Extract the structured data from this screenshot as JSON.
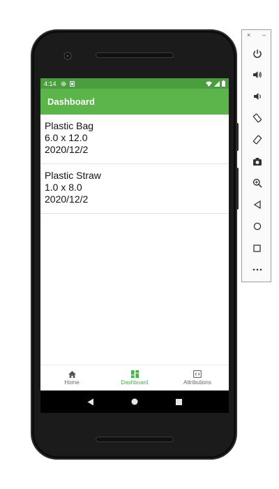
{
  "status_bar": {
    "time": "4:14",
    "icons": [
      "settings-icon",
      "sim-icon",
      "wifi-icon",
      "signal-icon",
      "battery-icon"
    ]
  },
  "app_bar": {
    "title": "Dashboard"
  },
  "list": {
    "items": [
      {
        "name": "Plastic Bag",
        "size": "6.0 x 12.0",
        "date": "2020/12/2"
      },
      {
        "name": "Plastic Straw",
        "size": "1.0 x 8.0",
        "date": "2020/12/2"
      }
    ]
  },
  "bottom_nav": {
    "items": [
      {
        "label": "Home",
        "icon": "home-icon",
        "active": false
      },
      {
        "label": "Dashboard",
        "icon": "dashboard-icon",
        "active": true
      },
      {
        "label": "Attributions",
        "icon": "code-icon",
        "active": false
      }
    ]
  },
  "system_nav": {
    "icons": [
      "back-icon",
      "home-circle-icon",
      "recents-icon"
    ]
  },
  "emulator_toolbar": {
    "close_glyph": "×",
    "minimize_glyph": "–",
    "buttons": [
      "power-icon",
      "volume-up-icon",
      "volume-down-icon",
      "rotate-left-icon",
      "rotate-right-icon",
      "camera-icon",
      "zoom-icon",
      "back-icon",
      "home-icon",
      "overview-icon",
      "more-icon"
    ]
  },
  "colors": {
    "status_bar": "#4a9e3e",
    "app_bar": "#5cb54b",
    "active_nav": "#4caf50",
    "inactive_nav": "#666666"
  }
}
